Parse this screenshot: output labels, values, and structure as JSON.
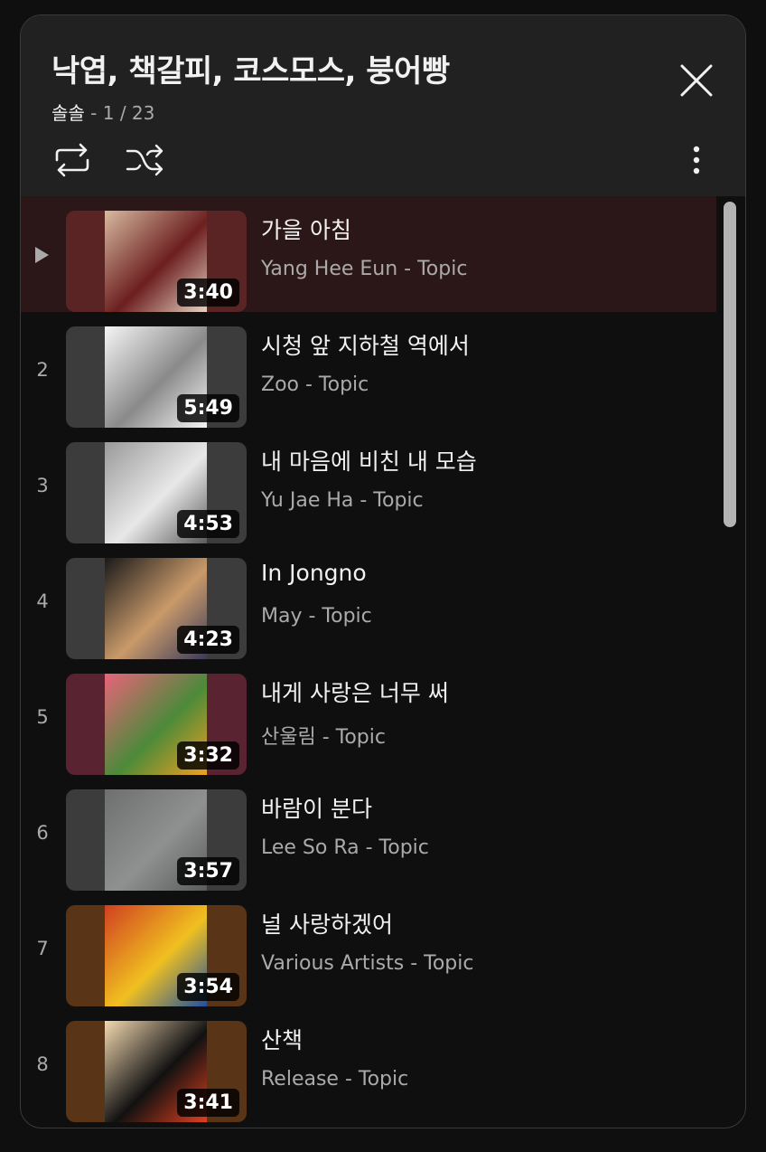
{
  "playlist": {
    "title": "낙엽, 책갈피, 코스모스, 붕어빵",
    "owner": "솔솔",
    "position": " - 1 / 23"
  },
  "icons": {
    "close": "close-icon",
    "loop": "loop-icon",
    "shuffle": "shuffle-icon",
    "more": "more-vert-icon",
    "now_playing": "play-arrow-icon"
  },
  "colors": {
    "panel_bg": "#0f0f0f",
    "header_bg": "#212121",
    "active_row_bg": "#2c1718",
    "secondary_text": "#aaaaaa"
  },
  "tracks": [
    {
      "index": "",
      "title": "가을 아침",
      "artist": "Yang Hee Eun - Topic",
      "duration": "3:40",
      "thumb_bg": "#5a2424",
      "active": true
    },
    {
      "index": "2",
      "title": "시청 앞 지하철 역에서",
      "artist": "Zoo - Topic",
      "duration": "5:49",
      "thumb_bg": "#3c3c3c"
    },
    {
      "index": "3",
      "title": "내 마음에 비친 내 모습",
      "artist": "Yu Jae Ha - Topic",
      "duration": "4:53",
      "thumb_bg": "#3c3c3c"
    },
    {
      "index": "4",
      "title": "In Jongno",
      "artist": "May - Topic",
      "duration": "4:23",
      "thumb_bg": "#3c3c3c"
    },
    {
      "index": "5",
      "title": "내게 사랑은 너무 써",
      "artist": "산울림 - Topic",
      "duration": "3:32",
      "thumb_bg": "#5a2332"
    },
    {
      "index": "6",
      "title": "바람이 분다",
      "artist": "Lee So Ra - Topic",
      "duration": "3:57",
      "thumb_bg": "#3c3c3c"
    },
    {
      "index": "7",
      "title": "널 사랑하겠어",
      "artist": "Various Artists - Topic",
      "duration": "3:54",
      "thumb_bg": "#5a3416"
    },
    {
      "index": "8",
      "title": "산책",
      "artist": "Release - Topic",
      "duration": "3:41",
      "thumb_bg": "#5a3416"
    }
  ]
}
